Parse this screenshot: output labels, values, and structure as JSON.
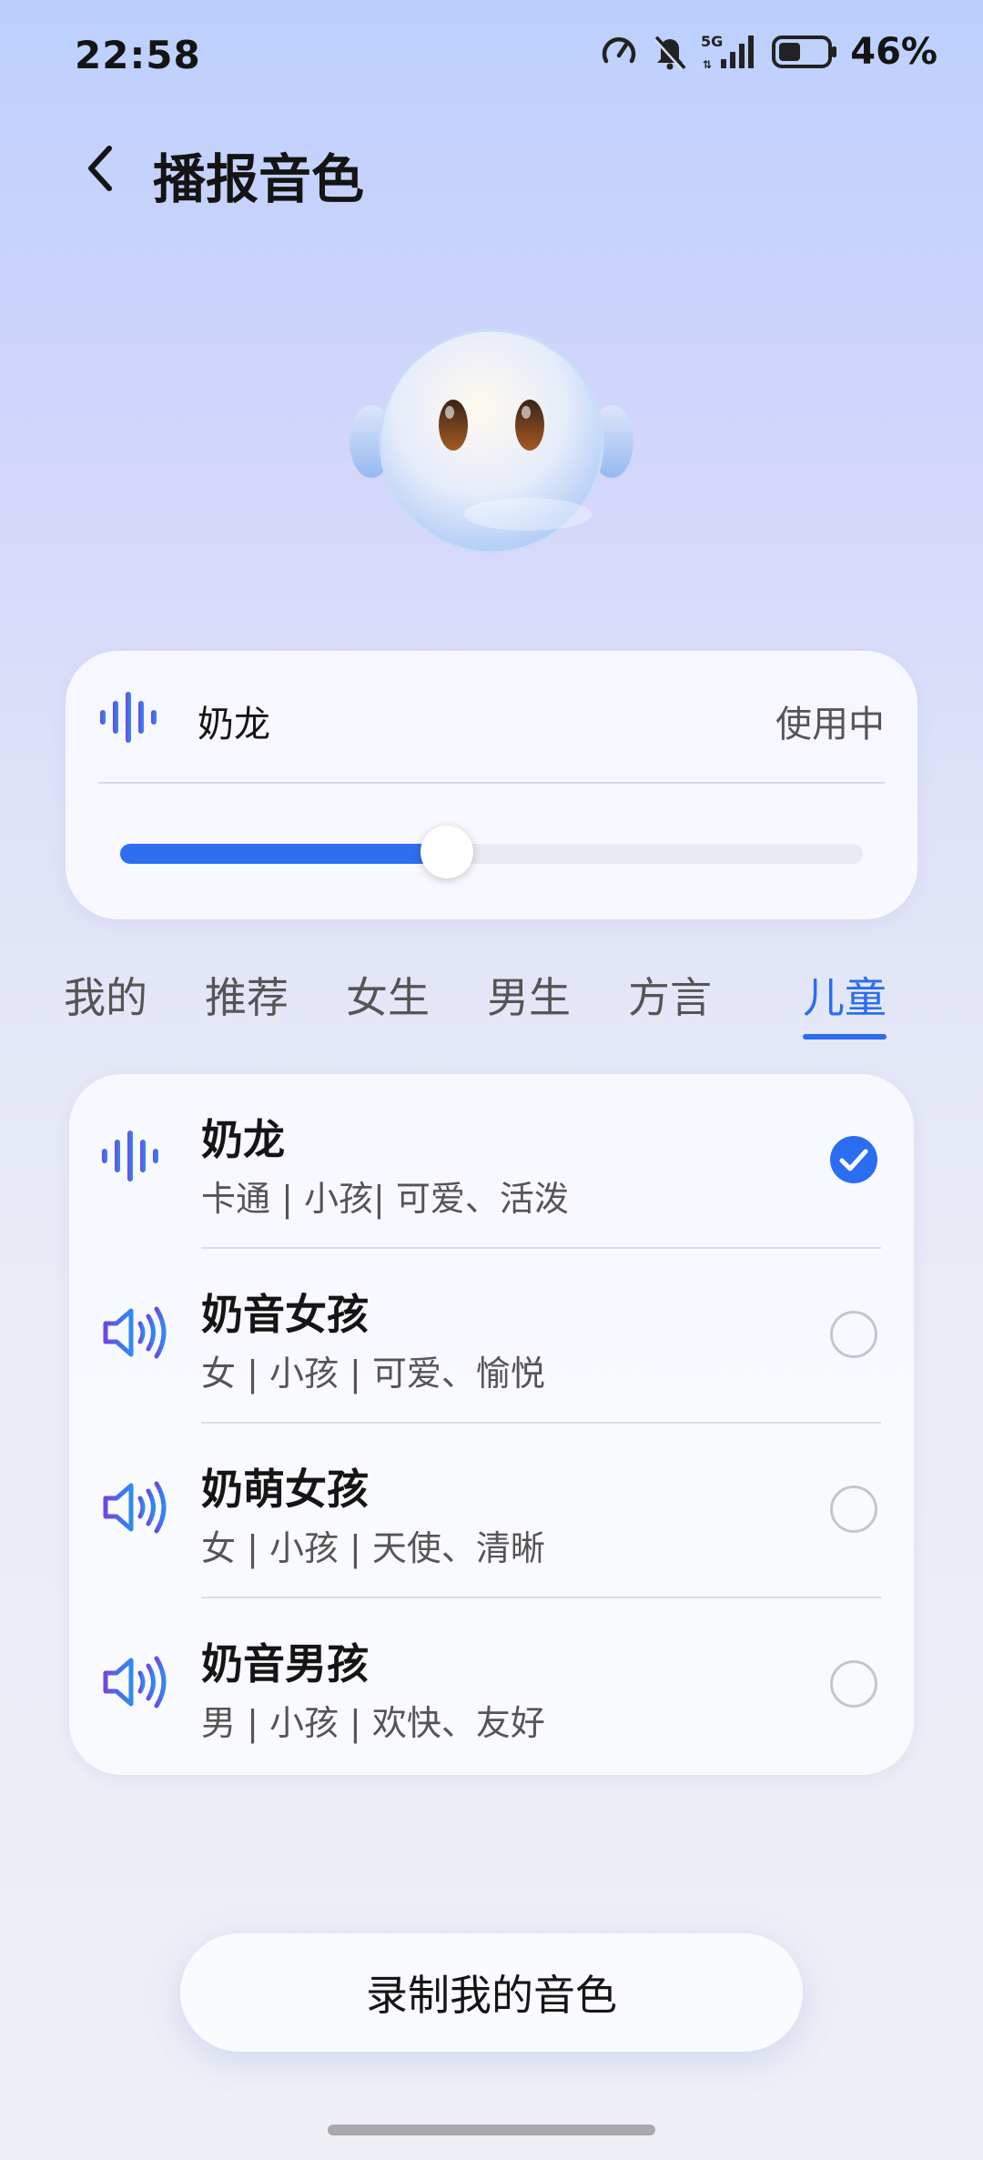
{
  "status_bar": {
    "time": "22:58",
    "network": "5G",
    "battery_percent": "46%",
    "battery_level": 0.46,
    "icons": [
      "speed-meter-icon",
      "bell-muted-icon",
      "signal-5g-icon",
      "battery-icon"
    ]
  },
  "header": {
    "back_icon": "chevron-left-icon",
    "title": "播报音色"
  },
  "current_voice": {
    "icon": "waveform-icon",
    "name": "奶龙",
    "status": "使用中",
    "slider_value": 0.44
  },
  "tabs": [
    {
      "label": "我的",
      "active": false
    },
    {
      "label": "推荐",
      "active": false
    },
    {
      "label": "女生",
      "active": false
    },
    {
      "label": "男生",
      "active": false
    },
    {
      "label": "方言",
      "active": false
    },
    {
      "label": "儿童",
      "active": true
    }
  ],
  "voices": [
    {
      "icon": "waveform-icon",
      "title": "奶龙",
      "desc": "卡通 | 小孩| 可爱、活泼",
      "selected": true
    },
    {
      "icon": "speaker-icon",
      "title": "奶音女孩",
      "desc": "女 | 小孩 | 可爱、愉悦",
      "selected": false
    },
    {
      "icon": "speaker-icon",
      "title": "奶萌女孩",
      "desc": "女 | 小孩 | 天使、清晰",
      "selected": false
    },
    {
      "icon": "speaker-icon",
      "title": "奶音男孩",
      "desc": "男 | 小孩 | 欢快、友好",
      "selected": false
    }
  ],
  "record_button": "录制我的音色",
  "colors": {
    "accent": "#2a6df0",
    "icon_gradient_start": "#6a4ae0",
    "icon_gradient_end": "#2f8bf0"
  }
}
